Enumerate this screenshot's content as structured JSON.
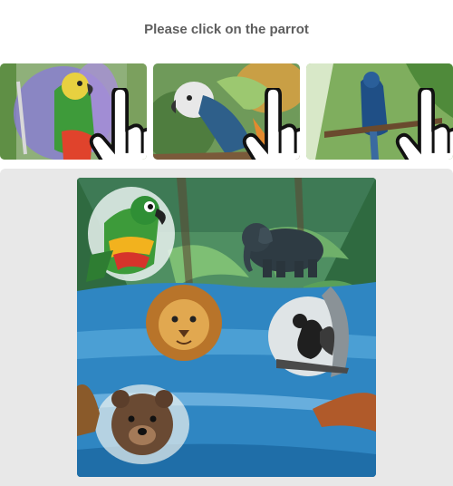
{
  "prompt": {
    "text": "Please click on the parrot"
  },
  "examples": [
    {
      "subject": "parrot"
    },
    {
      "subject": "parrot"
    },
    {
      "subject": "parrot"
    }
  ],
  "scene": {
    "animals": [
      "parrot",
      "elephant",
      "lion",
      "squirrel",
      "bear"
    ]
  }
}
